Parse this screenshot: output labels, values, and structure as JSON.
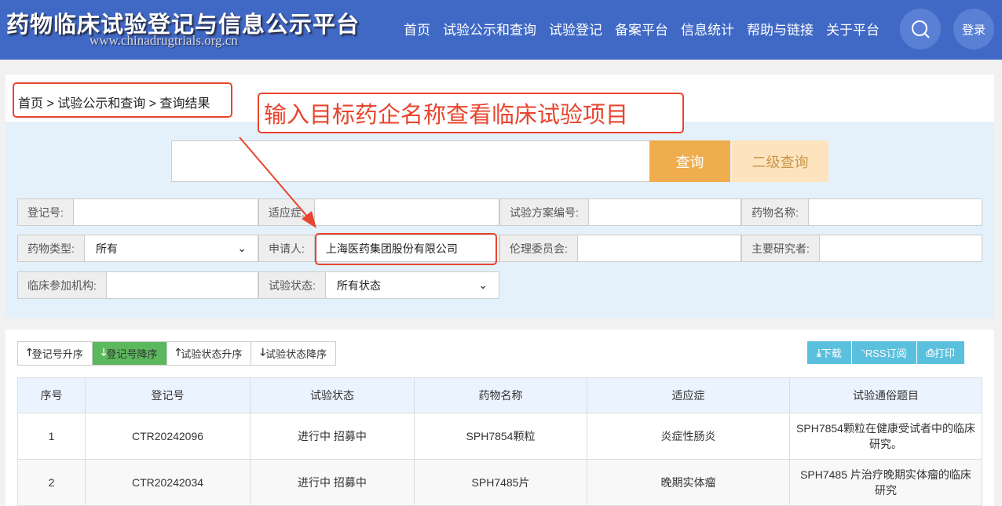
{
  "header": {
    "title": "药物临床试验登记与信息公示平台",
    "url": "www.chinadrugtrials.org.cn",
    "nav": [
      "首页",
      "试验公示和查询",
      "试验登记",
      "备案平台",
      "信息统计",
      "帮助与链接",
      "关于平台"
    ],
    "login": "登录"
  },
  "breadcrumb": "首页 > 试验公示和查询 > 查询结果",
  "annotation": "输入目标药企名称查看临床试验项目",
  "search": {
    "query_label": "查询",
    "advanced_label": "二级查询"
  },
  "fields": [
    {
      "label": "登记号:",
      "value": ""
    },
    {
      "label": "适应症:",
      "value": ""
    },
    {
      "label": "试验方案编号:",
      "value": ""
    },
    {
      "label": "药物名称:",
      "value": ""
    },
    {
      "label": "药物类型:",
      "value": "所有"
    },
    {
      "label": "申请人:",
      "value": "上海医药集团股份有限公司"
    },
    {
      "label": "伦理委员会:",
      "value": ""
    },
    {
      "label": "主要研究者:",
      "value": ""
    },
    {
      "label": "临床参加机构:",
      "value": ""
    },
    {
      "label": "试验状态:",
      "value": "所有状态"
    }
  ],
  "sort": [
    "登记号升序",
    "登记号降序",
    "试验状态升序",
    "试验状态降序"
  ],
  "tools": [
    "下载",
    "RSS订阅",
    "打印"
  ],
  "table": {
    "headers": [
      "序号",
      "登记号",
      "试验状态",
      "药物名称",
      "适应症",
      "试验通俗题目"
    ],
    "rows": [
      [
        "1",
        "CTR20242096",
        "进行中 招募中",
        "SPH7854颗粒",
        "炎症性肠炎",
        "SPH7854颗粒在健康受试者中的临床研究。"
      ],
      [
        "2",
        "CTR20242034",
        "进行中 招募中",
        "SPH7485片",
        "晚期实体瘤",
        "SPH7485 片治疗晚期实体瘤的临床研究"
      ]
    ]
  }
}
